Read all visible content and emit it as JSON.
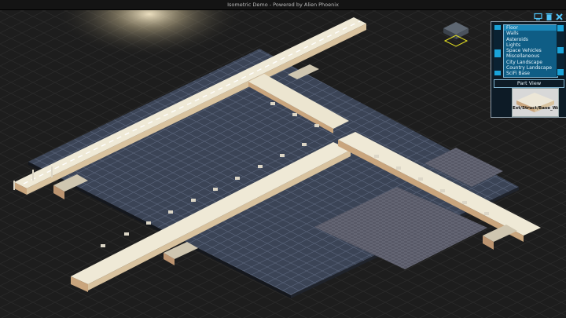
{
  "window": {
    "title": "Isometric Demo - Powered by Alien Phoenix"
  },
  "toolbar": {
    "icons": [
      "monitor-icon",
      "trash-icon",
      "close-icon"
    ],
    "icon_color": "#4fc3f7"
  },
  "part_browser": {
    "categories": [
      "Floor",
      "Walls",
      "Asteroids",
      "Lights",
      "Space Vehicles",
      "Miscellaneous",
      "City Landscape",
      "Country Landscape",
      "SciFi Base"
    ],
    "selected_index": 0,
    "part_view_title": "Part View",
    "preview_label": "Ext/Struct/Base_Wall"
  },
  "colors": {
    "background": "#1b1b1b",
    "floor_tile": "#3b4456",
    "grate_tile": "#555562",
    "road": "#e7e1cf",
    "road_side": "#c9a57d",
    "panel_bg": "#0f5d85",
    "panel_highlight": "#1a86b8"
  }
}
